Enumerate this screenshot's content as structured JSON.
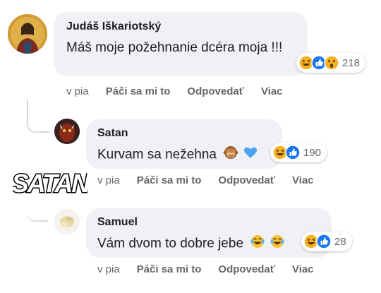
{
  "comments": [
    {
      "author": "Judáš Iškariotský",
      "text": "Máš moje požehnanie dcéra moja !!!",
      "reaction_count": "218",
      "reaction_icons": [
        "haha-icon",
        "like-icon",
        "wow-icon"
      ],
      "time": "v pia",
      "like_label": "Páči sa mi to",
      "reply_label": "Odpovedať",
      "more_label": "Viac"
    },
    {
      "author": "Satan",
      "text": "Kurvam sa nežehna",
      "inline_emojis": [
        "see-no-evil-monkey-emoji",
        "blue-heart-emoji"
      ],
      "reaction_count": "190",
      "reaction_icons": [
        "haha-icon",
        "like-icon"
      ],
      "time": "v pia",
      "like_label": "Páči sa mi to",
      "reply_label": "Odpovedať",
      "more_label": "Viac"
    },
    {
      "author": "Samuel",
      "text": "Vám dvom to dobre jebe",
      "inline_emojis": [
        "tears-of-joy-emoji",
        "tears-of-joy-emoji"
      ],
      "reaction_count": "28",
      "reaction_icons": [
        "haha-icon",
        "like-icon"
      ],
      "time": "v pia",
      "like_label": "Páči sa mi to",
      "reply_label": "Odpovedať",
      "more_label": "Viac"
    }
  ],
  "sticker_text": "SATAN",
  "colors": {
    "bubble": "#eff1f4",
    "meta_text": "#65676b",
    "like_blue": "#1877f2",
    "haha_yellow": "#f7b125"
  }
}
